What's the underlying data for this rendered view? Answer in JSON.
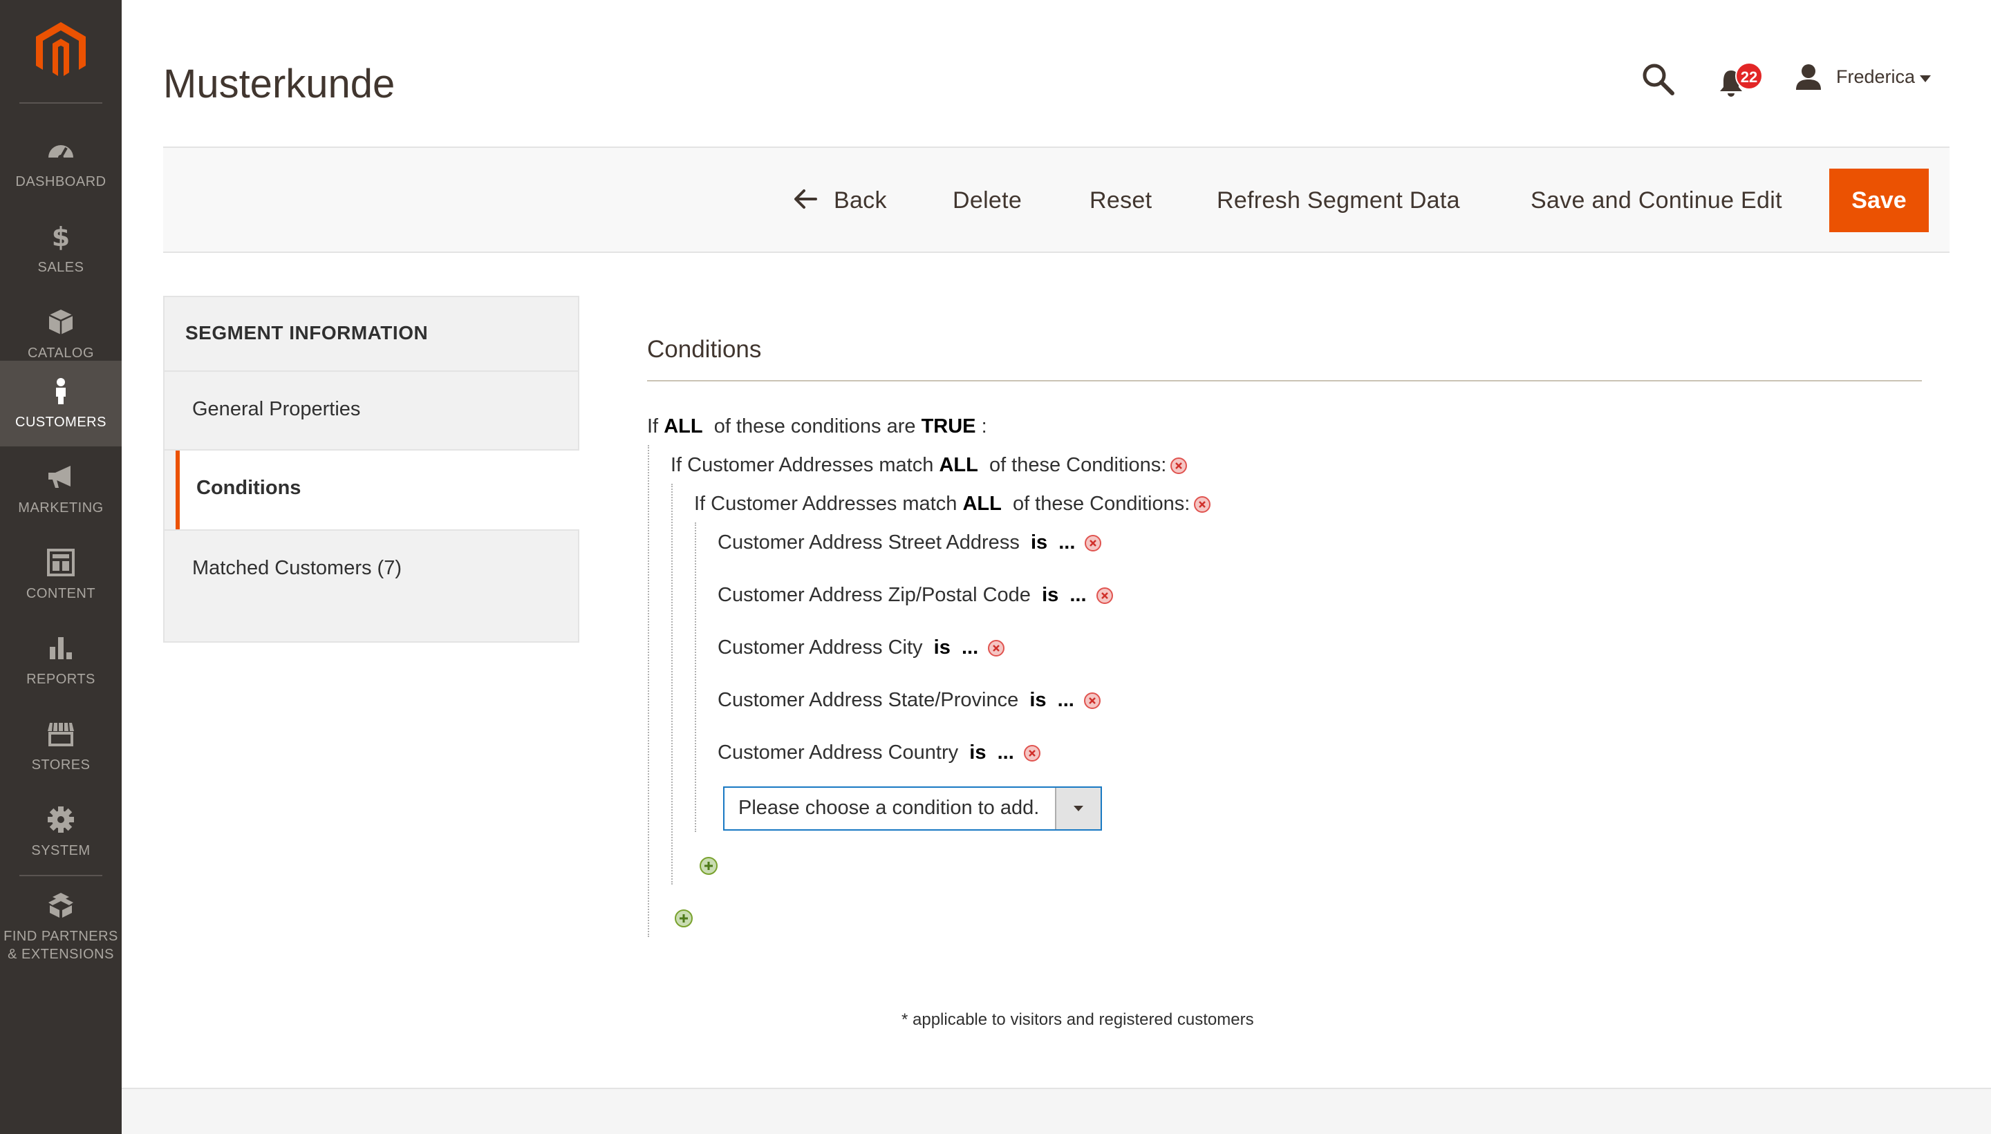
{
  "nav": {
    "items": [
      {
        "label": "DASHBOARD",
        "icon": "dashboard-icon"
      },
      {
        "label": "SALES",
        "icon": "dollar-icon"
      },
      {
        "label": "CATALOG",
        "icon": "box-icon"
      },
      {
        "label": "CUSTOMERS",
        "icon": "person-icon",
        "active": true
      },
      {
        "label": "MARKETING",
        "icon": "megaphone-icon"
      },
      {
        "label": "CONTENT",
        "icon": "layout-icon"
      },
      {
        "label": "REPORTS",
        "icon": "bar-chart-icon"
      },
      {
        "label": "STORES",
        "icon": "storefront-icon"
      },
      {
        "label": "SYSTEM",
        "icon": "gear-icon"
      },
      {
        "label_line1": "FIND PARTNERS",
        "label_line2": "& EXTENSIONS",
        "icon": "cubes-icon"
      }
    ]
  },
  "header": {
    "title": "Musterkunde",
    "notification_count": "22",
    "user_name": "Frederica"
  },
  "actions": {
    "back": "Back",
    "delete": "Delete",
    "reset": "Reset",
    "refresh": "Refresh Segment Data",
    "save_continue": "Save and Continue Edit",
    "save": "Save"
  },
  "tabs": {
    "title": "SEGMENT INFORMATION",
    "items": [
      {
        "label": "General Properties"
      },
      {
        "label": "Conditions",
        "active": true
      },
      {
        "label": "Matched Customers (7)"
      }
    ]
  },
  "conditions": {
    "heading": "Conditions",
    "root": {
      "prefix": "If",
      "aggregator": "ALL",
      "middle": "of these conditions are",
      "value": "TRUE",
      "suffix": ":"
    },
    "group1": {
      "prefix": "If Customer Addresses match",
      "aggregator": "ALL",
      "suffix": "of these Conditions:"
    },
    "group2": {
      "prefix": "If Customer Addresses match",
      "aggregator": "ALL",
      "suffix": "of these Conditions:"
    },
    "rules": [
      {
        "attribute": "Customer Address Street Address",
        "operator": "is",
        "value": "..."
      },
      {
        "attribute": "Customer Address Zip/Postal Code",
        "operator": "is",
        "value": "..."
      },
      {
        "attribute": "Customer Address City",
        "operator": "is",
        "value": "..."
      },
      {
        "attribute": "Customer Address State/Province",
        "operator": "is",
        "value": "..."
      },
      {
        "attribute": "Customer Address Country",
        "operator": "is",
        "value": "..."
      }
    ],
    "select_placeholder": "Please choose a condition to add."
  },
  "footnote": "* applicable to visitors and registered customers",
  "colors": {
    "nav_bg": "#373330",
    "accent": "#eb5202",
    "remove_icon": "#e0534f",
    "add_icon": "#79a22e"
  }
}
